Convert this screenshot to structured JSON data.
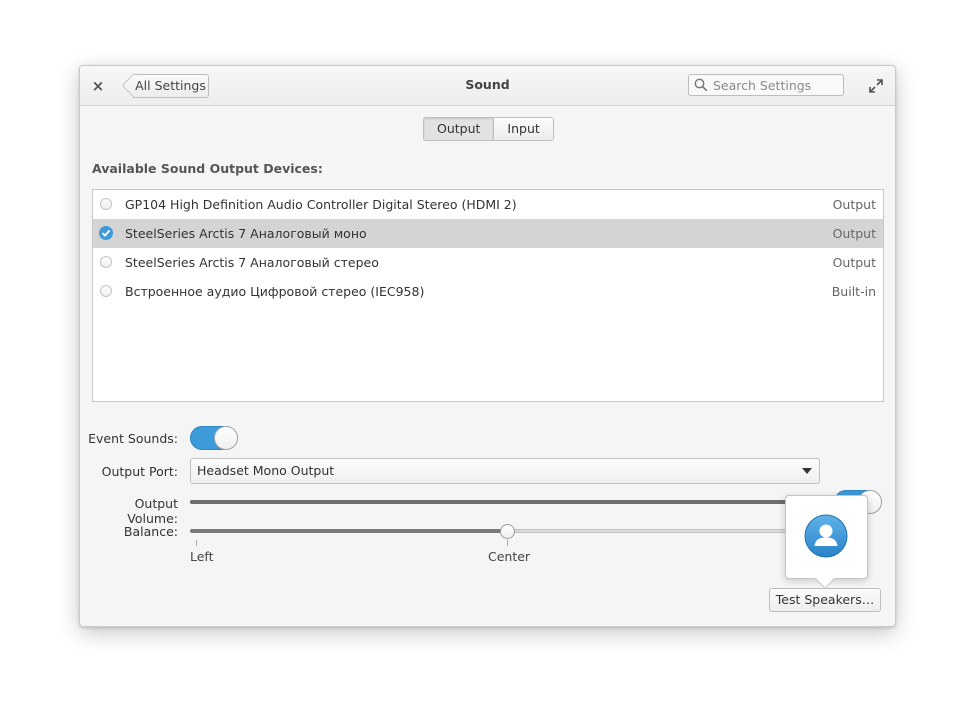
{
  "window": {
    "title": "Sound"
  },
  "header": {
    "close_label": "×",
    "back_label": "All Settings",
    "search_placeholder": "Search Settings"
  },
  "mode_switch": {
    "options": [
      "Output",
      "Input"
    ],
    "selected": "Output"
  },
  "devices": {
    "title": "Available Sound Output Devices:",
    "items": [
      {
        "name": "GP104 High Definition Audio Controller Digital Stereo (HDMI 2)",
        "type": "Output",
        "selected": false
      },
      {
        "name": "SteelSeries Arctis 7 Аналоговый моно",
        "type": "Output",
        "selected": true
      },
      {
        "name": "SteelSeries Arctis 7 Аналоговый стерео",
        "type": "Output",
        "selected": false
      },
      {
        "name": "Встроенное аудио Цифровой стерео (IEC958)",
        "type": "Built-in",
        "selected": false
      }
    ]
  },
  "settings": {
    "event_sounds_label": "Event Sounds:",
    "event_sounds_on": true,
    "output_port_label": "Output Port:",
    "output_port_value": "Headset Mono Output",
    "output_volume_label": "Output Volume:",
    "output_volume_fraction": 1.0,
    "output_volume_toggle_on": true,
    "balance_label": "Balance:",
    "balance_fraction": 0.5,
    "balance_marks": {
      "left": "Left",
      "center": "Center"
    }
  },
  "test_speakers_label": "Test Speakers…",
  "colors": {
    "accent": "#3d9bda"
  }
}
